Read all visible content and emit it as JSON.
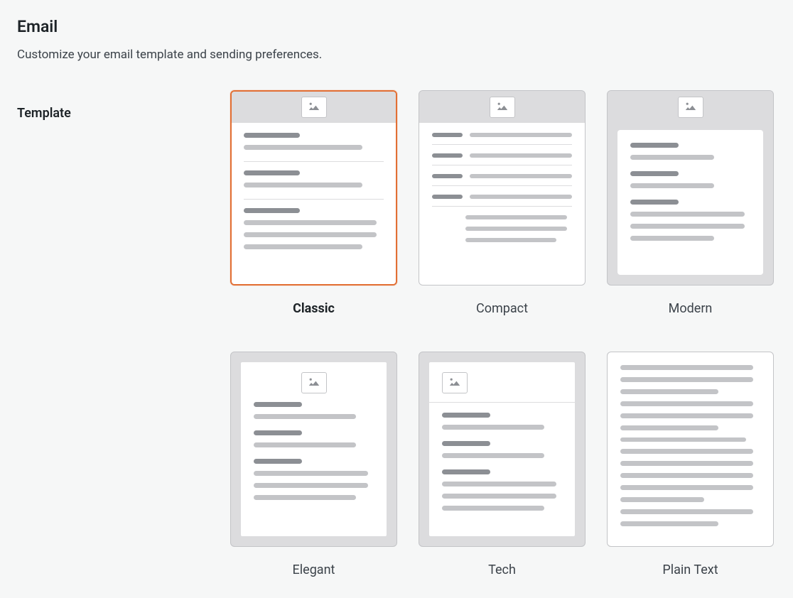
{
  "page": {
    "title": "Email",
    "description": "Customize your email template and sending preferences.",
    "section_label": "Template"
  },
  "templates": [
    {
      "id": "classic",
      "label": "Classic",
      "selected": true
    },
    {
      "id": "compact",
      "label": "Compact",
      "selected": false
    },
    {
      "id": "modern",
      "label": "Modern",
      "selected": false
    },
    {
      "id": "elegant",
      "label": "Elegant",
      "selected": false
    },
    {
      "id": "tech",
      "label": "Tech",
      "selected": false
    },
    {
      "id": "plaintext",
      "label": "Plain Text",
      "selected": false
    }
  ],
  "colors": {
    "accent": "#e26f34",
    "border": "#c3c4c7",
    "bar_dark": "#8c8f94",
    "bar_light": "#c3c4c7",
    "panel_bg": "#dcdcde"
  }
}
